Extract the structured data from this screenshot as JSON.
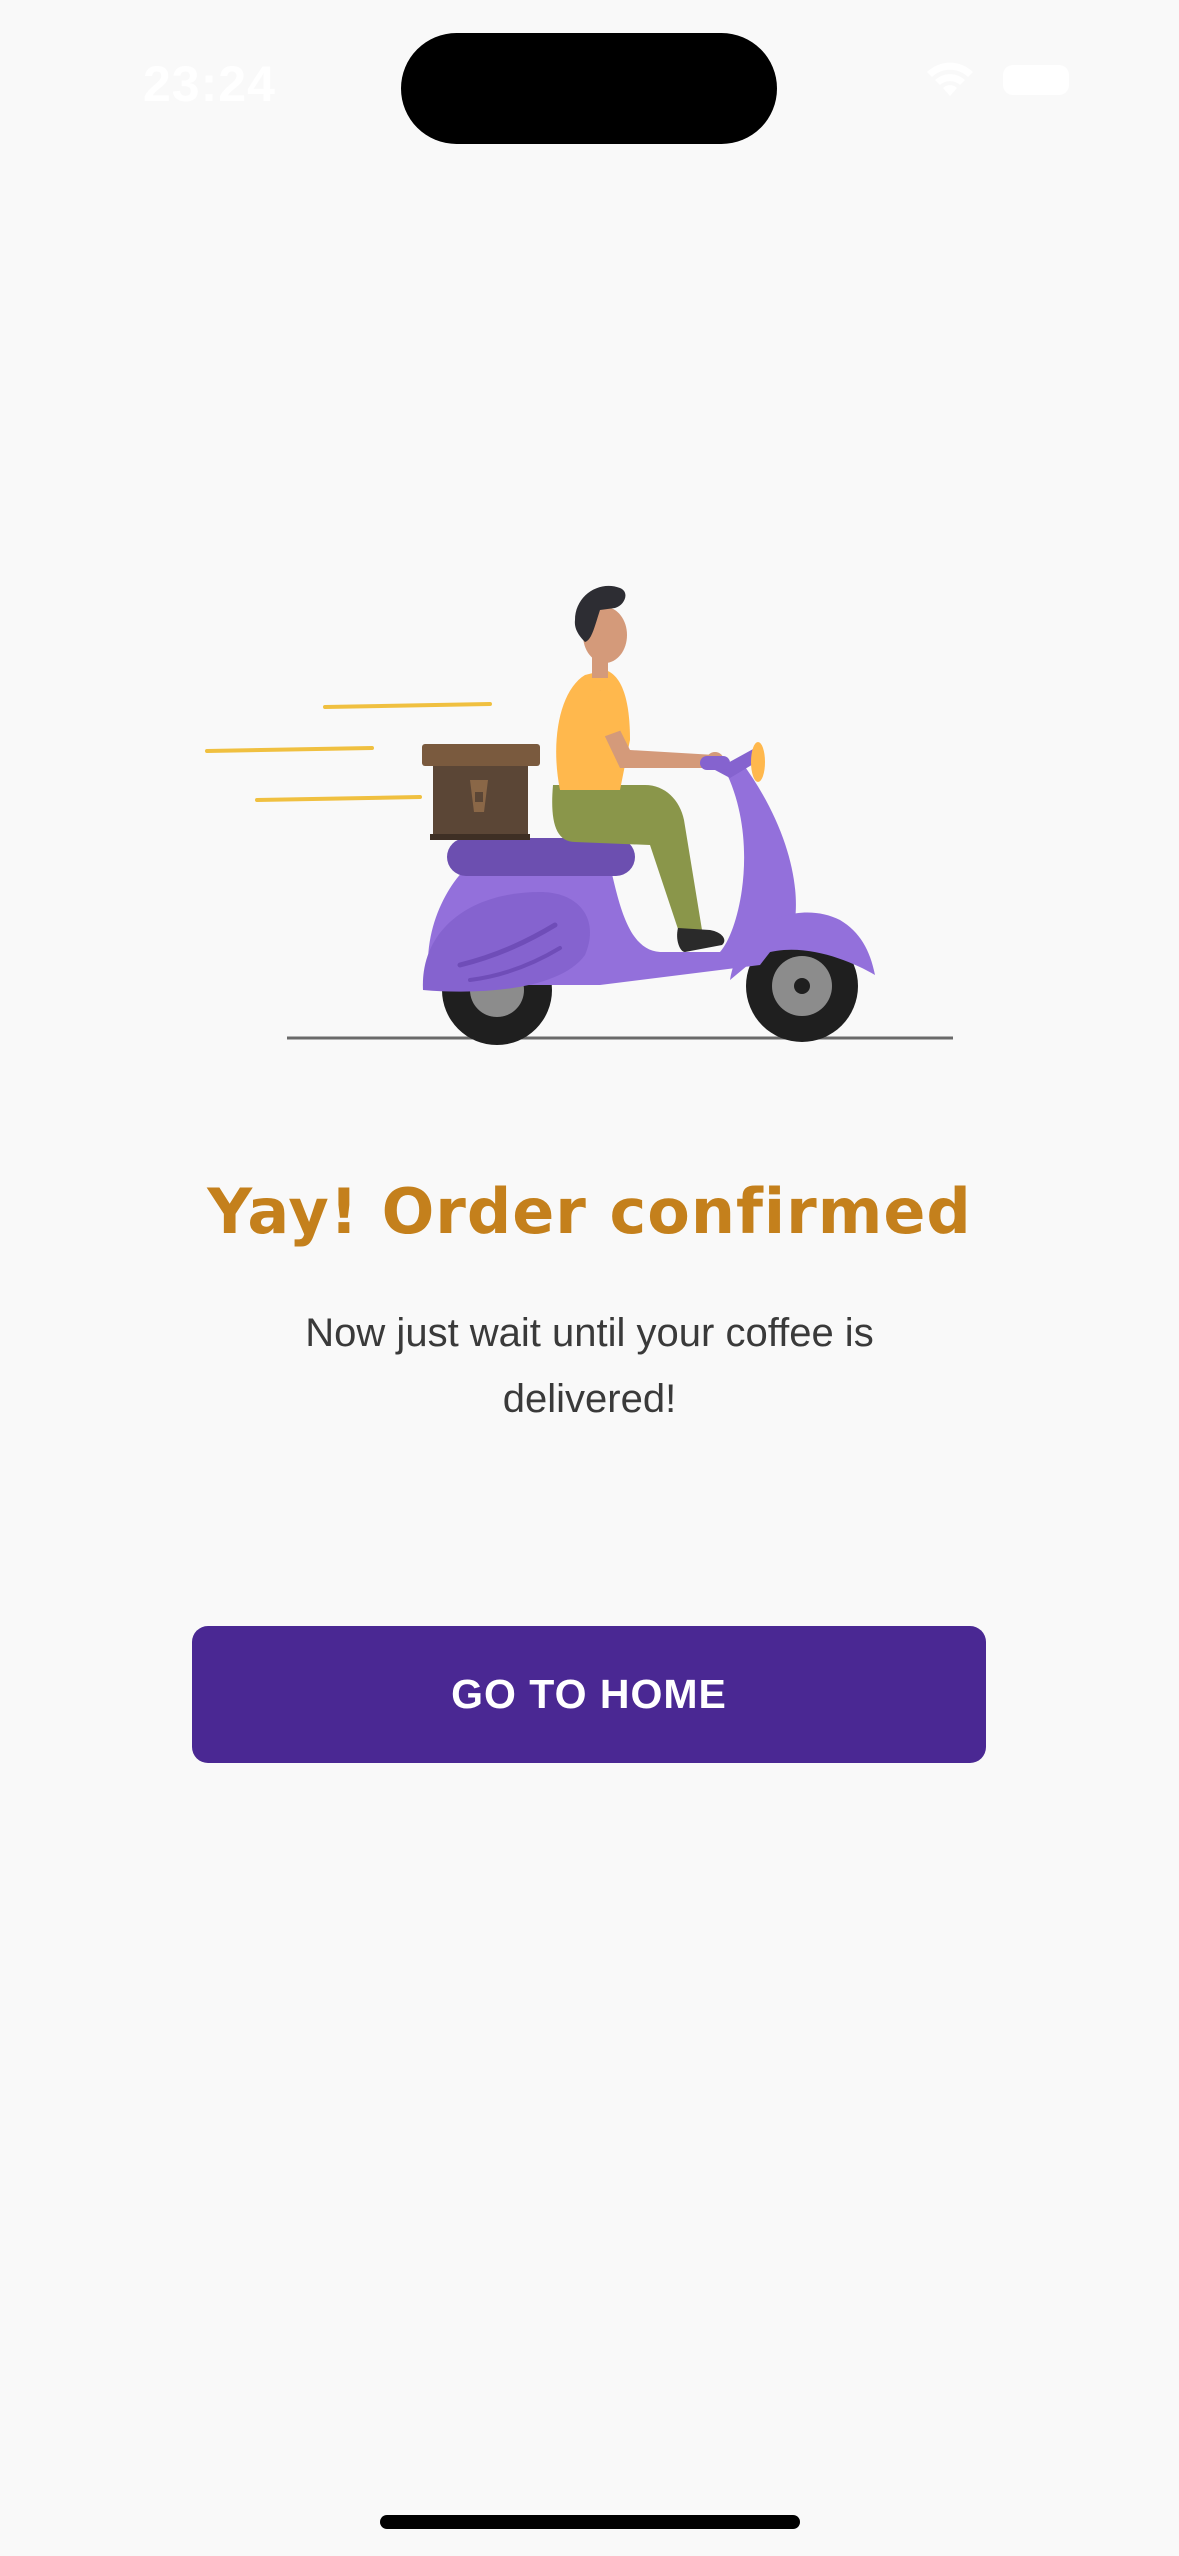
{
  "status_bar": {
    "time": "23:24",
    "wifi_icon": "wifi-icon",
    "battery_icon": "battery-icon"
  },
  "illustration": {
    "description_icon": "delivery-scooter-illustration",
    "colors": {
      "scooter": "#9370db",
      "box": "#5b4636",
      "shirt": "#ffb84d",
      "pants": "#8a964a",
      "speed_lines": "#f0c040"
    }
  },
  "confirmation": {
    "title": "Yay! Order confirmed",
    "message": "Now just wait until your coffee is delivered!"
  },
  "actions": {
    "home_label": "GO TO HOME"
  },
  "colors": {
    "background": "#f9f9f9",
    "title": "#c4801c",
    "button": "#4a2893",
    "button_text": "#ffffff"
  }
}
